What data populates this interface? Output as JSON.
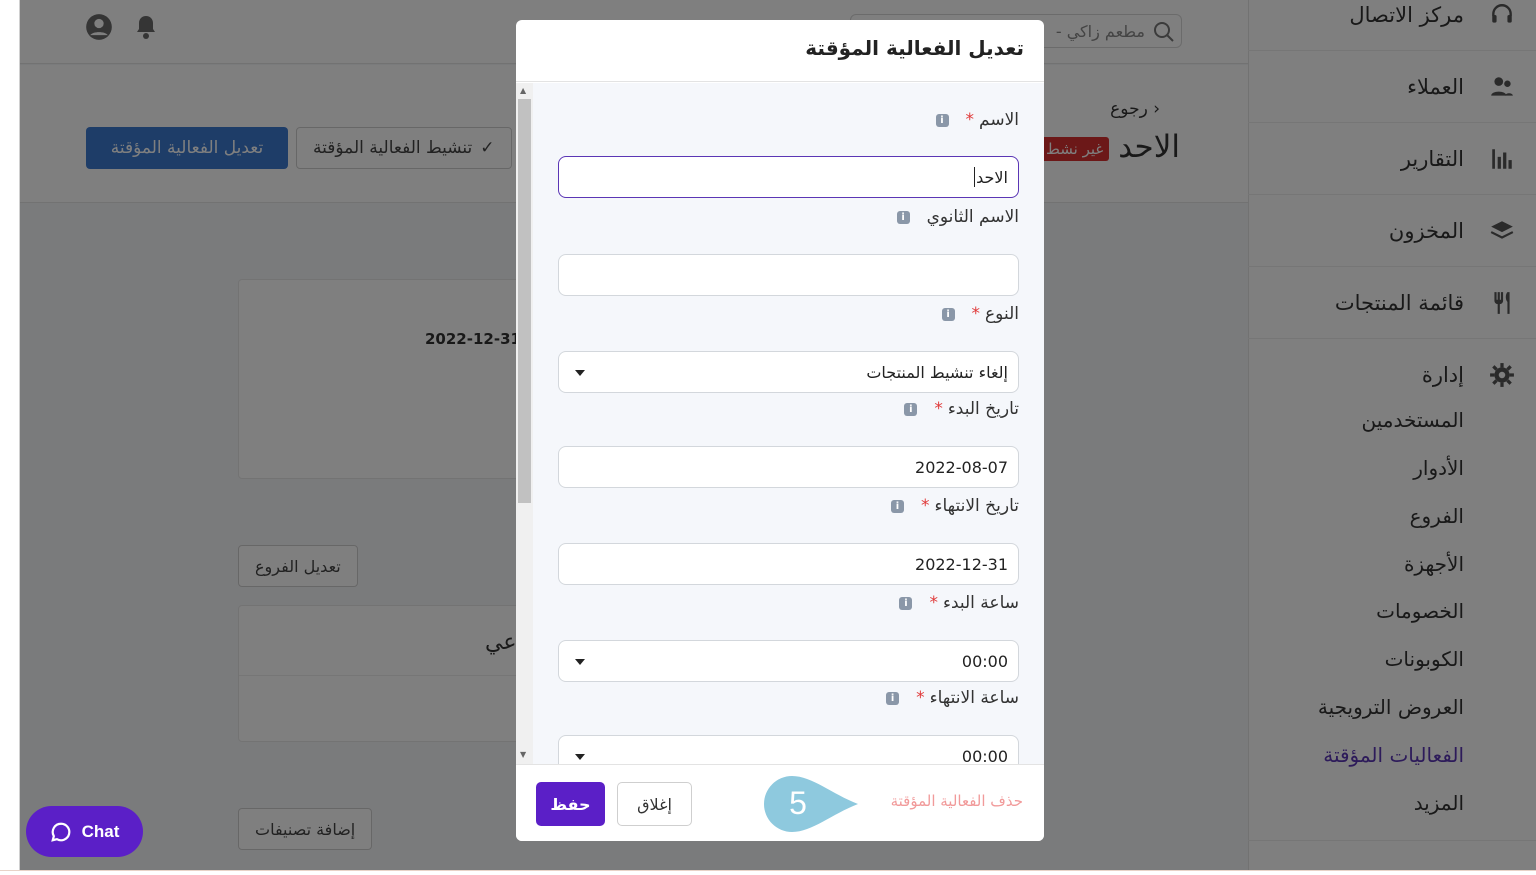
{
  "search": {
    "placeholder": "مطعم زاكي -"
  },
  "page": {
    "back_label": "رجوع",
    "title": "الاحد",
    "status_badge": "غير نشط",
    "activate_button": "تنشيط الفعالية المؤقتة",
    "edit_button": "تعديل الفعالية المؤقتة",
    "card_date": "2022-12-31",
    "edit_branches_button": "تعديل الفروع",
    "card_partial_text": "عي",
    "add_categories_button": "إضافة تصنيفات"
  },
  "sidebar": {
    "items": [
      {
        "label": "مركز الاتصال",
        "icon": "headset-icon"
      },
      {
        "label": "العملاء",
        "icon": "users-icon"
      },
      {
        "label": "التقارير",
        "icon": "bar-chart-icon"
      },
      {
        "label": "المخزون",
        "icon": "layers-icon"
      },
      {
        "label": "قائمة المنتجات",
        "icon": "utensils-icon"
      },
      {
        "label": "إدارة",
        "icon": "gear-icon"
      }
    ],
    "sub_items": [
      "المستخدمين",
      "الأدوار",
      "الفروع",
      "الأجهزة",
      "الخصومات",
      "الكوبونات",
      "العروض الترويجية",
      "الفعاليات المؤقتة",
      "المزيد"
    ],
    "active_sub_item": "الفعاليات المؤقتة"
  },
  "modal": {
    "title": "تعديل الفعالية المؤقتة",
    "fields": {
      "name": {
        "label": "الاسم",
        "value": "الاحد",
        "required": true
      },
      "secondary_name": {
        "label": "الاسم الثانوي",
        "value": "",
        "required": false
      },
      "type": {
        "label": "النوع",
        "value": "إلغاء تنشيط المنتجات",
        "required": true
      },
      "start_date": {
        "label": "تاريخ البدء",
        "value": "2022-08-07",
        "required": true
      },
      "end_date": {
        "label": "تاريخ الانتهاء",
        "value": "2022-12-31",
        "required": true
      },
      "start_time": {
        "label": "ساعة البدء",
        "value": "00:00",
        "required": true
      },
      "end_time": {
        "label": "ساعة الانتهاء",
        "value": "00:00",
        "required": true
      }
    },
    "required_mark": "*",
    "info_glyph": "i",
    "save_button": "حفظ",
    "close_button": "إغلاق",
    "delete_link": "حذف الفعالية المؤقتة",
    "step_number": "5"
  },
  "chat": {
    "label": "Chat"
  },
  "colors": {
    "primary": "#5b1fc7",
    "accent_blue": "#3c7ad1",
    "danger": "#d93030",
    "marker": "#8ec9de"
  }
}
